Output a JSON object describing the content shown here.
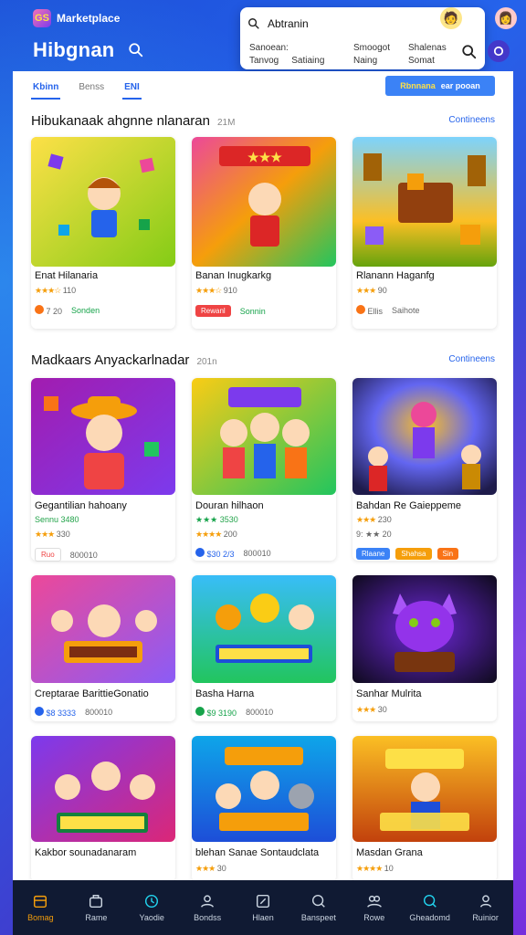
{
  "app": {
    "name": "Marketplace",
    "logo_glyph": "GS"
  },
  "header": {
    "title": "Hibgnan"
  },
  "search": {
    "value": "Abtranin",
    "suggestions": [
      {
        "line1": "Sanoean:",
        "line2": "Tanvog",
        "line3": "Satiaing"
      },
      {
        "line1": "Smoogot",
        "line2": "Naing",
        "line3": ""
      },
      {
        "line1": "Shalenas",
        "line2": "Somat",
        "line3": ""
      }
    ]
  },
  "tabs": [
    {
      "label": "Kbinn",
      "active": true
    },
    {
      "label": "Benss",
      "active": false
    },
    {
      "label": "ENI",
      "active": true
    }
  ],
  "action_button": {
    "highlight": "Rbnnana",
    "label": "ear pooan"
  },
  "sections": [
    {
      "title": "Hibukanaak ahgnne nlanaran",
      "count": "21M",
      "link": "Contineens",
      "cards": [
        {
          "title": "Enat Hilanaria",
          "rating_stars": "★★★☆",
          "rating_value": "110",
          "meta": [
            "7 20",
            "Sonden"
          ],
          "art": "yellow"
        },
        {
          "title": "Banan Inugkarkg",
          "rating_stars": "★★★☆",
          "rating_value": "910",
          "meta": [
            "Sonnin"
          ],
          "pill": "Rewanl",
          "art": "pink"
        },
        {
          "title": "Rlanann Haganfg",
          "rating_stars": "★★★",
          "rating_value": "90",
          "meta": [
            "Ellis",
            "Saihote"
          ],
          "art": "green"
        }
      ]
    },
    {
      "title": "Madkaars Anyackarlnadar",
      "count": "201n",
      "link": "Contineens",
      "cards": [
        {
          "title": "Gegantilian hahoany",
          "sub": "Sennu 3480",
          "rating_stars": "★★★",
          "rating_value": "330",
          "meta": [
            "Ruo",
            "800010"
          ],
          "art": "purple"
        },
        {
          "title": "Douran hilhaon",
          "sub": "3530",
          "rating_stars": "★★★★",
          "rating_value": "200",
          "meta": [
            "$30 2/3",
            "800010"
          ],
          "art": "yellow2"
        },
        {
          "title": "Bahdan Re Gaieppeme",
          "rating_stars": "★★★",
          "rating_value": "230",
          "meta": [
            "9: ★★ 20"
          ],
          "pills": [
            "Rlaane",
            "Shahsa",
            "Sin"
          ],
          "art": "blue"
        },
        {
          "title": "Creptarae BarittieGonatio",
          "rating_stars": "",
          "rating_value": "",
          "meta": [
            "$8 3333",
            "800010"
          ],
          "art": "magenta"
        },
        {
          "title": "Basha Harna",
          "rating_stars": "",
          "rating_value": "",
          "meta": [
            "$9 3190",
            "800010"
          ],
          "art": "sky"
        },
        {
          "title": "Sanhar Mulrita",
          "rating_stars": "★★★",
          "rating_value": "30",
          "meta": [],
          "art": "dark"
        },
        {
          "title": "Kakbor sounadanaram",
          "rating_stars": "",
          "rating_value": "",
          "meta": [],
          "art": "violet"
        },
        {
          "title": "blehan Sanae Sontaudclata",
          "rating_stars": "★★★",
          "rating_value": "30",
          "meta": [],
          "art": "cyan"
        },
        {
          "title": "Masdan Grana",
          "rating_stars": "★★★★",
          "rating_value": "10",
          "meta": [],
          "art": "orange"
        }
      ]
    }
  ],
  "bottom_nav": [
    {
      "label": "Bomag",
      "icon": "store-icon",
      "active": true
    },
    {
      "label": "Rame",
      "icon": "briefcase-icon",
      "active": false
    },
    {
      "label": "Yaodie",
      "icon": "clock-icon",
      "active": false
    },
    {
      "label": "Bondss",
      "icon": "person-icon",
      "active": false
    },
    {
      "label": "Hlaen",
      "icon": "edit-icon",
      "active": false
    },
    {
      "label": "Banspeet",
      "icon": "chat-icon",
      "active": false
    },
    {
      "label": "Rowe",
      "icon": "group-icon",
      "active": false
    },
    {
      "label": "Gheadomd",
      "icon": "search-icon",
      "active": false
    },
    {
      "label": "Ruinior",
      "icon": "profile-icon",
      "active": false
    }
  ],
  "colors": {
    "accent": "#2563eb",
    "star": "#f59e0b",
    "nav_bg": "#101a33",
    "active_nav": "#f59e0b"
  }
}
